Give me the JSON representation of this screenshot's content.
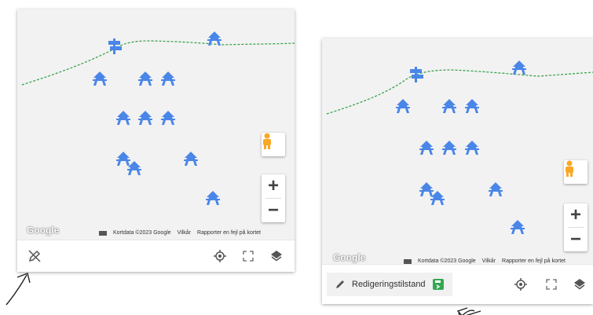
{
  "attribution": {
    "data": "Kortdata ©2023 Google",
    "terms": "Vilkår",
    "report": "Rapporter en fejl på kortet"
  },
  "google_logo": "Google",
  "zoom": {
    "in": "+",
    "out": "−"
  },
  "left_panel": {
    "edit_tool_icon": "edit-off-icon"
  },
  "right_panel": {
    "edit_mode_label": "Redigeringstilstand"
  },
  "colors": {
    "marker_blue": "#4a86e8",
    "route_green": "#2f9e44",
    "save_green": "#34a853"
  }
}
